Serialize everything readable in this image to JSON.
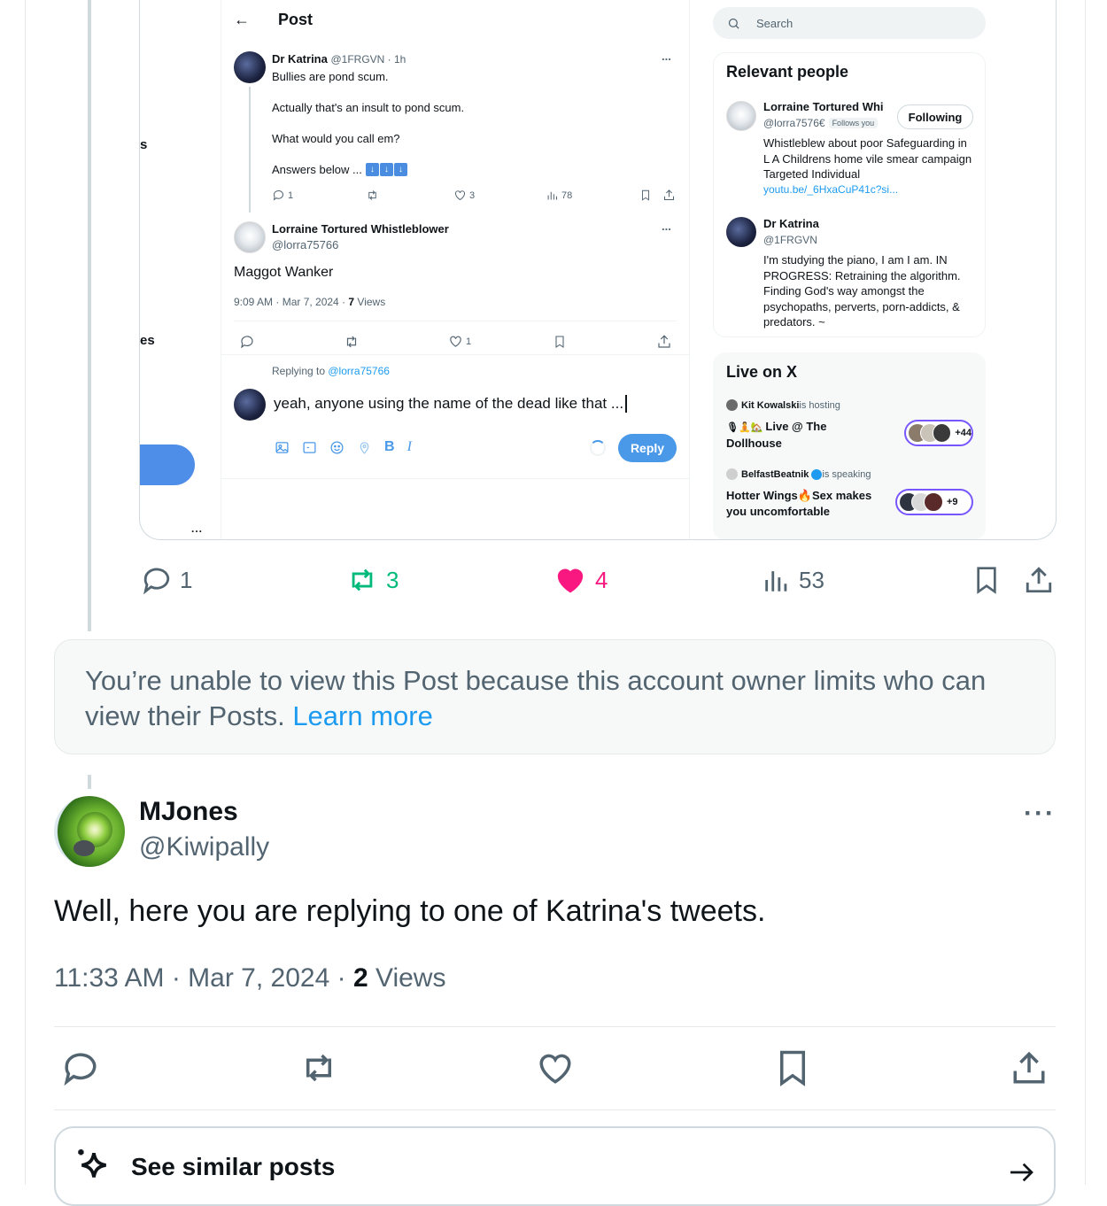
{
  "embedded": {
    "left_nav": {
      "item1": "s",
      "item2": "es",
      "more": "..."
    },
    "header": {
      "back": "←",
      "title": "Post"
    },
    "tweet1": {
      "name": "Dr Katrina",
      "handle_time": "@1FRGVN · 1h",
      "line1": "Bullies are pond scum.",
      "line2": "Actually that's an insult to pond scum.",
      "line3": "What would you call em?",
      "line4": "Answers below ...",
      "replies": "1",
      "likes": "3",
      "views": "78",
      "more": "..."
    },
    "tweet2": {
      "name": "Lorraine Tortured Whistleblower",
      "handle": "@lorra75766",
      "text": "Maggot Wanker",
      "meta": "9:09 AM · Mar 7, 2024 · ",
      "views_count": "7",
      "views_label": " Views",
      "likes": "1",
      "more": "..."
    },
    "reply_box": {
      "replying_to_label": "Replying to ",
      "replying_to_handle": "@lorra75766",
      "draft": "yeah, anyone using the name of the dead like that ...",
      "reply_button": "Reply",
      "bold_label": "B",
      "italic_label": "I"
    },
    "search": {
      "placeholder": "Search"
    },
    "relevant_people": {
      "title": "Relevant people",
      "person1": {
        "name": "Lorraine Tortured Whi",
        "handle": "@lorra7576€",
        "follows_you": "Follows you",
        "button": "Following",
        "bio": "Whistleblew about poor Safeguarding in L A Childrens home vile smear campaign Targeted Individual",
        "link": "youtu.be/_6HxaCuP41c?si..."
      },
      "person2": {
        "name": "Dr Katrina",
        "handle": "@1FRGVN",
        "bio": "I'm studying the piano, I am I am. IN PROGRESS: Retraining the algorithm. Finding God's way amongst the psychopaths, perverts, porn-addicts, & predators. ~"
      }
    },
    "live": {
      "title": "Live on X",
      "space1": {
        "host": "Kit Kowalski",
        "status": " is hosting",
        "title_a": "Live @ The",
        "title_b": "Dollhouse",
        "count": "+44"
      },
      "space2": {
        "host": "BelfastBeatnik",
        "status": " is speaking",
        "title_a": "Hotter Wings",
        "title_a2": "Sex makes",
        "title_b": "you uncomfortable",
        "count": "+9"
      }
    }
  },
  "quoted_actions": {
    "replies": "1",
    "reposts": "3",
    "likes": "4",
    "views": "53"
  },
  "notice": {
    "text": "You’re unable to view this Post because this account owner limits who can view their Posts. ",
    "link": "Learn more"
  },
  "post": {
    "name": "MJones",
    "handle": "@Kiwipally",
    "text": "Well, here you are replying to one of Katrina's tweets.",
    "time": "11:33 AM · Mar 7, 2024 · ",
    "views_count": "2",
    "views_label": " Views"
  },
  "see_similar": {
    "label": "See similar posts"
  },
  "colors": {
    "accent": "#1d9bf0",
    "like": "#f91880",
    "repost": "#00ba7c",
    "reply_button": "#4a99e9"
  }
}
